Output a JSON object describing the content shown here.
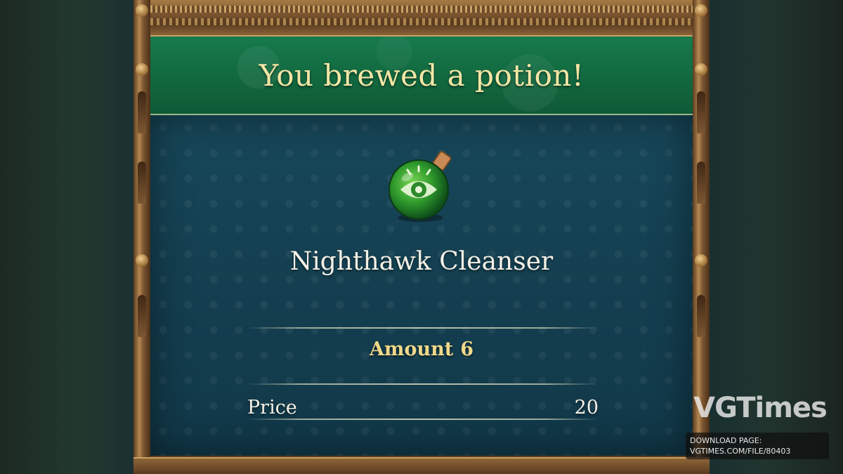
{
  "dialog": {
    "title": "You brewed a potion!",
    "potion_name": "Nighthawk Cleanser",
    "potion_icon": "green-potion-flask-icon",
    "amount_label": "Amount",
    "amount_value": "6",
    "price_label": "Price",
    "price_value": "20"
  },
  "watermark": {
    "logo": "VGTimes",
    "download_label": "DOWNLOAD PAGE:",
    "download_url": "VGTIMES.COM/FILE/80403"
  },
  "colors": {
    "banner": "#12683f",
    "panel": "#143f50",
    "title_text": "#f3e6a6",
    "amount_text": "#f0d98a"
  }
}
